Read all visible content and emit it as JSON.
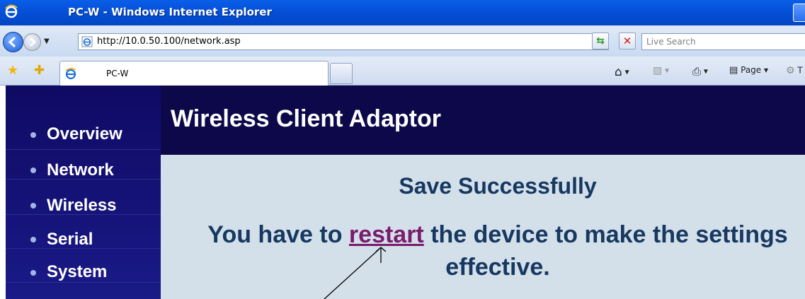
{
  "browser": {
    "window_title": "PC-W - Windows Internet Explorer",
    "address": "http://10.0.50.100/network.asp",
    "search_placeholder": "Live Search",
    "tab_title": "PC-W",
    "command_page": "Page",
    "command_tools_partial": "T"
  },
  "sidebar": {
    "items": [
      {
        "label": "Overview"
      },
      {
        "label": "Network"
      },
      {
        "label": "Wireless"
      },
      {
        "label": "Serial"
      },
      {
        "label": "System"
      }
    ]
  },
  "header": {
    "title": "Wireless Client Adaptor"
  },
  "main": {
    "save_message": "Save Successfully",
    "restart_prefix": "You have to ",
    "restart_link": "restart",
    "restart_suffix": " the device to make the settings effective."
  },
  "colors": {
    "sidebar_bg": "#120d6b",
    "header_bg": "#0c0849",
    "main_bg": "#d3e0ea",
    "text_dark_blue": "#173860",
    "link_purple": "#7a1c6c"
  }
}
